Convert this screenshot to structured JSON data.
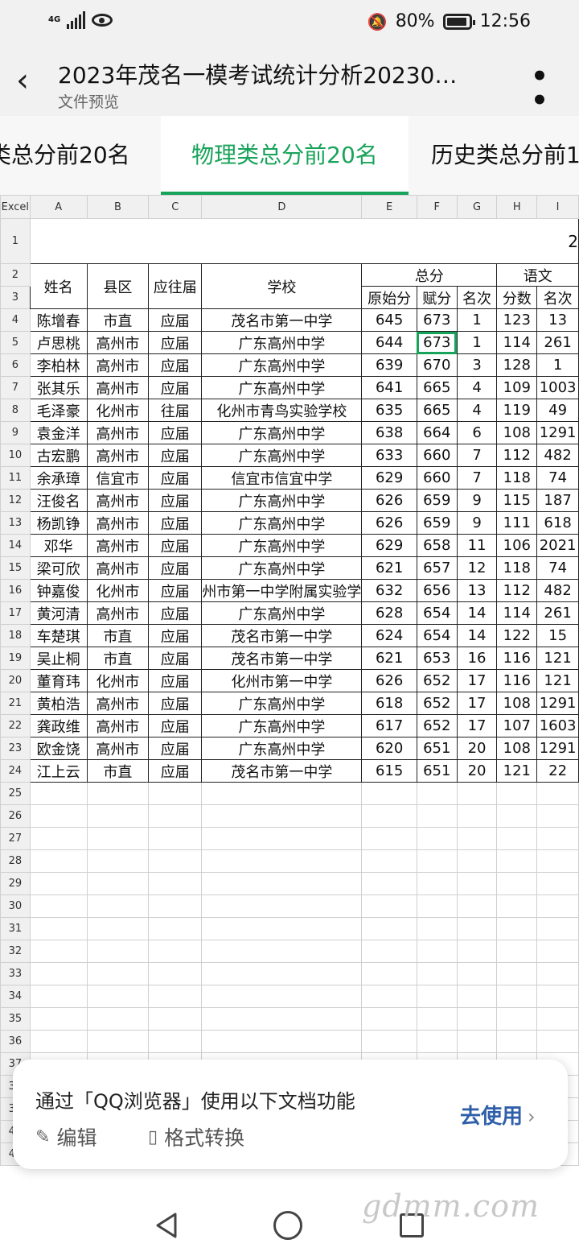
{
  "status": {
    "network": "4G",
    "battery": "80%",
    "time": "12:56"
  },
  "titlebar": {
    "title": "2023年茂名一模考试统计分析20230…",
    "subtitle": "文件预览"
  },
  "tabs": [
    "类总分前20名",
    "物理类总分前20名",
    "历史类总分前1"
  ],
  "sheet": {
    "corner": "Excel",
    "columns": [
      "A",
      "B",
      "C",
      "D",
      "E",
      "F",
      "G",
      "H",
      "I"
    ],
    "title_fragment": "2",
    "headers": {
      "name": "姓名",
      "county": "县区",
      "grade": "应往届",
      "school": "学校",
      "total": "总分",
      "raw": "原始分",
      "scaled": "赋分",
      "rank": "名次",
      "chinese": "语文",
      "score": "分数",
      "rank2": "名次"
    },
    "rows": [
      [
        "陈增春",
        "市直",
        "应届",
        "茂名市第一中学",
        "645",
        "673",
        "1",
        "123",
        "13"
      ],
      [
        "卢思桃",
        "高州市",
        "应届",
        "广东高州中学",
        "644",
        "673",
        "1",
        "114",
        "261"
      ],
      [
        "李柏林",
        "高州市",
        "应届",
        "广东高州中学",
        "639",
        "670",
        "3",
        "128",
        "1"
      ],
      [
        "张其乐",
        "高州市",
        "应届",
        "广东高州中学",
        "641",
        "665",
        "4",
        "109",
        "1003"
      ],
      [
        "毛泽豪",
        "化州市",
        "往届",
        "化州市青鸟实验学校",
        "635",
        "665",
        "4",
        "119",
        "49"
      ],
      [
        "袁金洋",
        "高州市",
        "应届",
        "广东高州中学",
        "638",
        "664",
        "6",
        "108",
        "1291"
      ],
      [
        "古宏鹏",
        "高州市",
        "应届",
        "广东高州中学",
        "633",
        "660",
        "7",
        "112",
        "482"
      ],
      [
        "余承璋",
        "信宜市",
        "应届",
        "信宜市信宜中学",
        "629",
        "660",
        "7",
        "118",
        "74"
      ],
      [
        "汪俊名",
        "高州市",
        "应届",
        "广东高州中学",
        "626",
        "659",
        "9",
        "115",
        "187"
      ],
      [
        "杨凯铮",
        "高州市",
        "应届",
        "广东高州中学",
        "626",
        "659",
        "9",
        "111",
        "618"
      ],
      [
        "邓华",
        "高州市",
        "应届",
        "广东高州中学",
        "629",
        "658",
        "11",
        "106",
        "2021"
      ],
      [
        "梁可欣",
        "高州市",
        "应届",
        "广东高州中学",
        "621",
        "657",
        "12",
        "118",
        "74"
      ],
      [
        "钟嘉俊",
        "化州市",
        "应届",
        "州市第一中学附属实验学",
        "632",
        "656",
        "13",
        "112",
        "482"
      ],
      [
        "黄河清",
        "高州市",
        "应届",
        "广东高州中学",
        "628",
        "654",
        "14",
        "114",
        "261"
      ],
      [
        "车楚琪",
        "市直",
        "应届",
        "茂名市第一中学",
        "624",
        "654",
        "14",
        "122",
        "15"
      ],
      [
        "吴止桐",
        "市直",
        "应届",
        "茂名市第一中学",
        "621",
        "653",
        "16",
        "116",
        "121"
      ],
      [
        "董育玮",
        "化州市",
        "应届",
        "化州市第一中学",
        "626",
        "652",
        "17",
        "116",
        "121"
      ],
      [
        "黄柏浩",
        "高州市",
        "应届",
        "广东高州中学",
        "618",
        "652",
        "17",
        "108",
        "1291"
      ],
      [
        "龚政维",
        "高州市",
        "应届",
        "广东高州中学",
        "617",
        "652",
        "17",
        "107",
        "1603"
      ],
      [
        "欧金饶",
        "高州市",
        "应届",
        "广东高州中学",
        "620",
        "651",
        "20",
        "108",
        "1291"
      ],
      [
        "江上云",
        "市直",
        "应届",
        "茂名市第一中学",
        "615",
        "651",
        "20",
        "121",
        "22"
      ]
    ],
    "empty_rows": [
      "25",
      "26",
      "27",
      "28",
      "29",
      "30",
      "31",
      "32",
      "33",
      "34",
      "35",
      "36",
      "37",
      "38",
      "39",
      "40",
      "41"
    ]
  },
  "banner": {
    "title": "通过「QQ浏览器」使用以下文档功能",
    "edit": "编辑",
    "convert": "格式转换",
    "action": "去使用"
  },
  "watermark": "gdmm.com"
}
